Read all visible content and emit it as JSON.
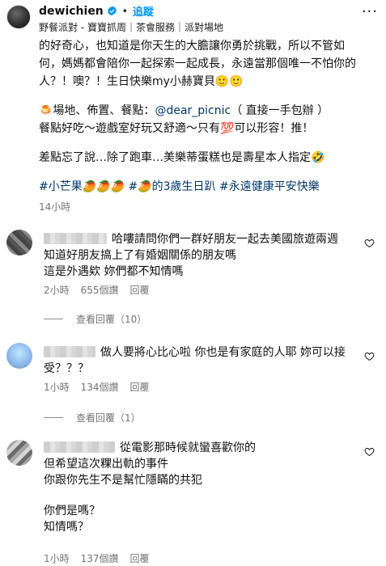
{
  "header": {
    "username": "dewichien",
    "follow_label": "追蹤",
    "dot": "•",
    "subtitle": "野餐派對 - 寶寶抓周｜茶會服務｜派對場地",
    "more": "···"
  },
  "caption": {
    "lines": [
      "的好奇心，也知道是你天生的大膽讓你勇於挑戰，所以不管如",
      "何，媽媽都會陪你一起探索一起成長，永遠當那個唯一不怕你的",
      "人？！噢？！生日快樂my小赫寶貝🙂🙂"
    ],
    "venue_prefix": "🍮場地、佈置、餐點：",
    "venue_mention": "@dear_picnic",
    "venue_suffix": "（ 直接一手包辦 ）",
    "food_line": "餐點好吃～遊戲室好玩又舒適～只有💯可以形容！推！",
    "cake_line": "差點忘了說…除了跑車…美樂蒂蛋糕也是壽星本人指定🤣",
    "tags": "#小芒果🥭🥭🥭 #🥭的3歲生日趴 #永遠健康平安快樂",
    "time_ago": "14小時"
  },
  "comments": [
    {
      "lines": [
        "哈嘍請問你們一群好朋友一起去美國旅遊兩週",
        "知道好朋友搞上了有婚姻關係的朋友嗎",
        "這是外遇欸 妳們都不知情嗎"
      ],
      "time": "2小時",
      "likes": "655個讚",
      "reply": "回覆",
      "view_replies": "查看回覆（10）"
    },
    {
      "lines": [
        "做人要將心比心啦 你也是有家庭的人耶 妳可以接",
        "受？？？"
      ],
      "time": "1小時",
      "likes": "134個讚",
      "reply": "回覆",
      "view_replies": "查看回覆（1）"
    },
    {
      "lines": [
        "從電影那時候就蠻喜歡你的",
        "但希望這次粿出軌的事件",
        "你跟你先生不是幫忙隱瞞的共犯",
        "",
        "你們是嗎？",
        "知情嗎？"
      ],
      "time": "1小時",
      "likes": "137個讚",
      "reply": "回覆"
    }
  ],
  "colors": {
    "link": "#00376b",
    "follow": "#0095f6",
    "muted": "#737373",
    "verified": "#0095f6"
  },
  "icons": [
    "verified-badge-icon",
    "heart-icon",
    "more-options-icon"
  ]
}
